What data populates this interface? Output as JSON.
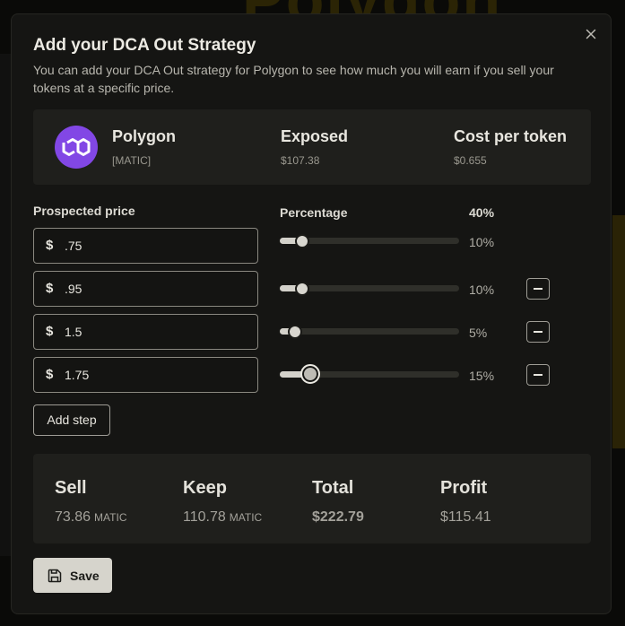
{
  "modal": {
    "title": "Add your DCA Out Strategy",
    "description": "You can add your DCA Out strategy for Polygon to see how much you will earn if you sell your tokens at a specific price."
  },
  "token": {
    "name": "Polygon",
    "symbol": "[MATIC]",
    "exposed_label": "Exposed",
    "exposed_value": "$107.38",
    "cost_label": "Cost per token",
    "cost_value": "$0.655",
    "logo_color": "#8247e5"
  },
  "steps_header": {
    "price_label": "Prospected price",
    "percentage_label": "Percentage",
    "total_percentage": "40%"
  },
  "steps": [
    {
      "currency": "$",
      "price": ".75",
      "percent": 10,
      "percent_label": "10%",
      "removable": false
    },
    {
      "currency": "$",
      "price": ".95",
      "percent": 10,
      "percent_label": "10%",
      "removable": true
    },
    {
      "currency": "$",
      "price": "1.5",
      "percent": 5,
      "percent_label": "5%",
      "removable": true
    },
    {
      "currency": "$",
      "price": "1.75",
      "percent": 15,
      "percent_label": "15%",
      "removable": true
    }
  ],
  "add_step_label": "Add step",
  "summary": {
    "sell": {
      "label": "Sell",
      "value": "73.86",
      "unit": "MATIC"
    },
    "keep": {
      "label": "Keep",
      "value": "110.78",
      "unit": "MATIC"
    },
    "total": {
      "label": "Total",
      "value": "$222.79"
    },
    "profit": {
      "label": "Profit",
      "value": "$115.41"
    }
  },
  "save_label": "Save",
  "backdrop_text": "Polygon"
}
